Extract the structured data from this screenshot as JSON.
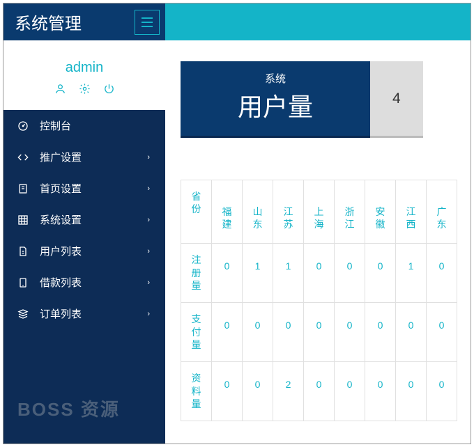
{
  "brand": "系统管理",
  "user": {
    "name": "admin"
  },
  "nav": [
    {
      "label": "控制台",
      "icon": "dashboard",
      "arrow": false
    },
    {
      "label": "推广设置",
      "icon": "code",
      "arrow": true
    },
    {
      "label": "首页设置",
      "icon": "page",
      "arrow": true
    },
    {
      "label": "系统设置",
      "icon": "grid",
      "arrow": true
    },
    {
      "label": "用户列表",
      "icon": "file",
      "arrow": true
    },
    {
      "label": "借款列表",
      "icon": "tablet",
      "arrow": true
    },
    {
      "label": "订单列表",
      "icon": "stack",
      "arrow": true
    }
  ],
  "watermark": "BOSS 资源",
  "card": {
    "sub": "系统",
    "title": "用户量",
    "value": "4"
  },
  "table": {
    "row_header": "省份",
    "cols": [
      "福建",
      "山东",
      "江苏",
      "上海",
      "浙江",
      "安徽",
      "江西",
      "广东"
    ],
    "rows": [
      {
        "label": "注册量",
        "vals": [
          "0",
          "1",
          "1",
          "0",
          "0",
          "0",
          "1",
          "0"
        ]
      },
      {
        "label": "支付量",
        "vals": [
          "0",
          "0",
          "0",
          "0",
          "0",
          "0",
          "0",
          "0"
        ]
      },
      {
        "label": "资料量",
        "vals": [
          "0",
          "0",
          "2",
          "0",
          "0",
          "0",
          "0",
          "0"
        ]
      }
    ]
  }
}
